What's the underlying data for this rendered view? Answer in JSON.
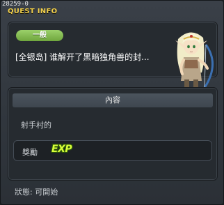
{
  "quest_id": "28259-0",
  "title": "QUEST INFO",
  "category_badge": "一般",
  "quest_name": "[全银岛] 谁解开了黑暗独角兽的封...",
  "npc": {
    "icon": "elf-archer-npc-portrait"
  },
  "content_section": {
    "header": "內容",
    "text": "射手村的"
  },
  "reward": {
    "label": "獎勵",
    "icon": "exp-icon",
    "icon_text": "EXP"
  },
  "status": {
    "label": "狀態:",
    "value": "可開始"
  },
  "colors": {
    "title": "#f2d04a",
    "badge": "#8cc456",
    "exp": "#d9ff3a"
  }
}
